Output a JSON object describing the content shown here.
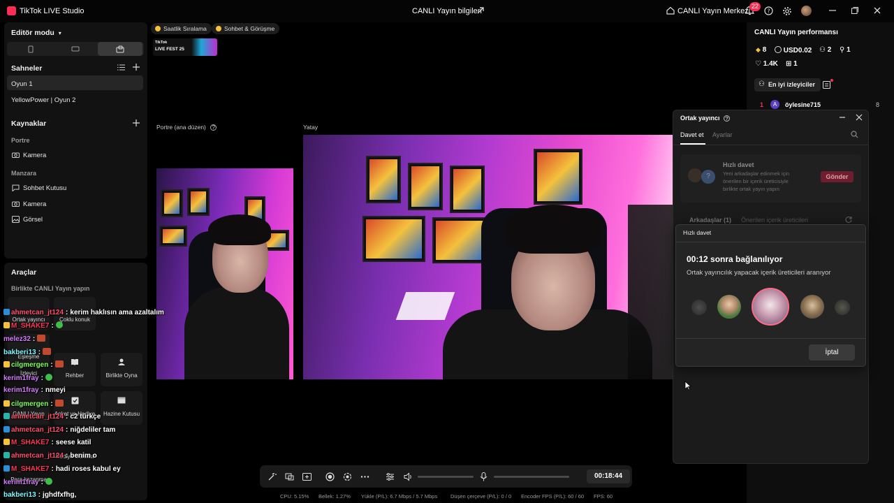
{
  "titlebar": {
    "app_name": "TikTok LIVE Studio",
    "center_title": "CANLI Yayın bilgileri",
    "live_center": "CANLI Yayın Merkezi",
    "notification_count": "22"
  },
  "left": {
    "mode_label": "Editör modu",
    "scenes_label": "Sahneler",
    "scenes": [
      {
        "label": "Oyun 1",
        "active": true
      },
      {
        "label": "YellowPower | Oyun 2",
        "active": false
      }
    ],
    "sources_label": "Kaynaklar",
    "portrait_label": "Portre",
    "portrait_items": [
      "Kamera"
    ],
    "landscape_label": "Manzara",
    "landscape_items": [
      "Sohbet Kutusu",
      "Kamera",
      "Görsel"
    ],
    "tools_label": "Araçlar",
    "tools_sub": "Birlikte CANLI Yayın yapın",
    "tools": [
      "Ortak yayıncı",
      "Çoklu konuk",
      "Eşleşme",
      "İzleyici",
      "Rehber",
      "Birlikte Oyna",
      "CANLI Yayın",
      "Anket ve Hediye",
      "Hazine Kutusu",
      "Hediye Galerisi",
      "Para kazanma"
    ]
  },
  "pills": [
    "Saatlik Sıralama",
    "Sohbet & Görüşme"
  ],
  "fest_badge": {
    "line1": "TikTok",
    "line2": "LIVE FEST 25"
  },
  "preview": {
    "portrait_label": "Portre (ana düzen)",
    "landscape_label": "Yatay"
  },
  "chat": [
    {
      "user": "ahmetcan_jt124",
      "sep": ":",
      "msg": "kerim haklısın ama azaltalım",
      "color": "#ff4d6d"
    },
    {
      "user": "M_SHAKE7",
      "sep": ":",
      "msg": "",
      "color": "#ff3355",
      "emote": "g"
    },
    {
      "user": "melez32",
      "sep": ":",
      "msg": "",
      "color": "#d77cff",
      "emote": "r"
    },
    {
      "user": "bakberi13",
      "sep": ":",
      "msg": "",
      "color": "#7df9ff",
      "emote": "r"
    },
    {
      "user": "cilgmergen",
      "sep": ":",
      "msg": "",
      "color": "#7dff5a",
      "emote": "r"
    },
    {
      "user": "kerim1fray",
      "sep": ":",
      "msg": "",
      "color": "#d77cff",
      "emote": "g"
    },
    {
      "user": "kerim1fray",
      "sep": ":",
      "msg": "nmeyi",
      "color": "#d77cff"
    },
    {
      "user": "cilgmergen",
      "sep": ":",
      "msg": "",
      "color": "#7dff5a",
      "emote": "r"
    },
    {
      "user": "ahmetcan_jt124",
      "sep": ":",
      "msg": "c2 türkçe",
      "color": "#ff4d6d"
    },
    {
      "user": "ahmetcan_jt124",
      "sep": ":",
      "msg": "niğdeliler tam",
      "color": "#ff4d6d"
    },
    {
      "user": "M_SHAKE7",
      "sep": ":",
      "msg": "seese katil",
      "color": "#ff3355"
    },
    {
      "user": "ahmetcan_jt124",
      "sep": ":",
      "msg": "benim o",
      "color": "#ff4d6d"
    },
    {
      "user": "M_SHAKE7",
      "sep": ":",
      "msg": "hadi roses kabul ey",
      "color": "#ff3355"
    },
    {
      "user": "kerim1fray",
      "sep": ":",
      "msg": "",
      "color": "#d77cff",
      "emote": "g"
    },
    {
      "user": "bakberi13",
      "sep": ":",
      "msg": "jghdfxfhg,",
      "color": "#7df9ff"
    }
  ],
  "bottom": {
    "timer": "00:18:44",
    "stats": {
      "cpu": "CPU:  5.15%",
      "mem": "Bellek:  1.27%",
      "upload": "Yükle (P/L):  6.7 Mbps / 5.7 Mbps",
      "dropped": "Düşen çerçeve (P/L):  0 / 0",
      "encoder": "Encoder FPS (P/L):  60 / 60",
      "fps": "FPS:  60"
    }
  },
  "right": {
    "title": "CANLI Yayın performansı",
    "diamonds": "8",
    "usd": "USD0.02",
    "viewers": "2",
    "new_followers": "1",
    "likes": "1.4K",
    "gifts": "1",
    "top_viewers_btn": "En iyi izleyiciler",
    "leader": {
      "rank": "1",
      "initial": "A",
      "name": "öylesine715",
      "score": "8"
    }
  },
  "cohost": {
    "title": "Ortak yayıncı",
    "tabs": [
      "Davet et",
      "Ayarlar"
    ],
    "quick_title": "Hızlı davet",
    "quick_desc": "Yeni arkadaşlar edinmek için önerilen bir içerik üreticisiyle birlikte ortak yayın yapın",
    "send_label": "Gönder",
    "friends_tab": "Arkadaşlar (1)",
    "suggested_tab": "Önerilen içerik üreticileri"
  },
  "modal": {
    "header": "Hızlı davet",
    "title": "00:12 sonra bağlanılıyor",
    "subtitle": "Ortak yayıncılık yapacak içerik üreticileri aranıyor",
    "cancel": "İptal"
  }
}
